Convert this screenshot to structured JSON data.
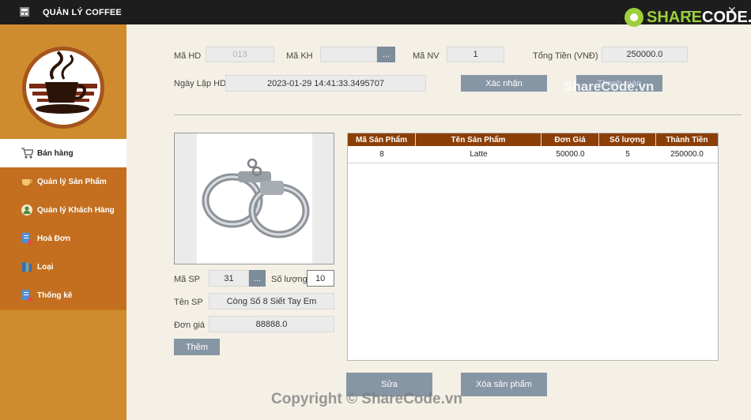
{
  "window": {
    "title": "QUẢN LÝ COFFEE",
    "minimize": "—",
    "close": "✕"
  },
  "sidebar": {
    "items": [
      {
        "label": "Bán hàng",
        "icon": "cart-icon",
        "active": true
      },
      {
        "label": "Quản lý Sản Phẩm",
        "icon": "coffee-cup-icon"
      },
      {
        "label": "Quản lý Khách Hàng",
        "icon": "customer-icon"
      },
      {
        "label": "Hoá Đơn",
        "icon": "invoice-icon"
      },
      {
        "label": "Loại",
        "icon": "books-icon"
      },
      {
        "label": "Thống kê",
        "icon": "report-icon"
      }
    ]
  },
  "order": {
    "ma_hd_label": "Mã HD",
    "ma_hd_value": "013",
    "ma_kh_label": "Mã KH",
    "ma_kh_value": "",
    "ma_kh_button": "...",
    "ma_nv_label": "Mã NV",
    "ma_nv_value": "1",
    "tong_tien_label": "Tổng Tiền (VNĐ)",
    "tong_tien_value": "250000.0",
    "ngay_lap_label": "Ngày Lập HD",
    "ngay_lap_value": "2023-01-29 14:41:33.3495707",
    "confirm_button": "Xác nhận",
    "pay_button": "Thanh toán"
  },
  "product": {
    "ma_sp_label": "Mã SP",
    "ma_sp_value": "31",
    "ma_sp_button": "...",
    "so_luong_label": "Số lượng",
    "so_luong_value": "10",
    "ten_sp_label": "Tên SP",
    "ten_sp_value": "Còng Số 8 Siết Tay Em",
    "don_gia_label": "Đơn giá",
    "don_gia_value": "88888.0",
    "add_button": "Thêm"
  },
  "table": {
    "columns": [
      "Mã Sản Phẩm",
      "Tên Sản Phẩm",
      "Đơn Giá",
      "Số lượng",
      "Thành Tiền"
    ],
    "rows": [
      [
        "8",
        "Latte",
        "50000.0",
        "5",
        "250000.0"
      ]
    ]
  },
  "actions": {
    "edit_button": "Sửa",
    "delete_button": "Xóa sản phẩm"
  },
  "watermarks": {
    "logo_text_green": "SHARE",
    "logo_text_white": "CODE.vn",
    "center": "ShareCode.vn",
    "bottom": "Copyright © ShareCode.vn"
  },
  "colors": {
    "sidebar": "#c78020",
    "header_row": "#8b3e06",
    "button": "#8796a5",
    "background": "#f4f0e6"
  }
}
